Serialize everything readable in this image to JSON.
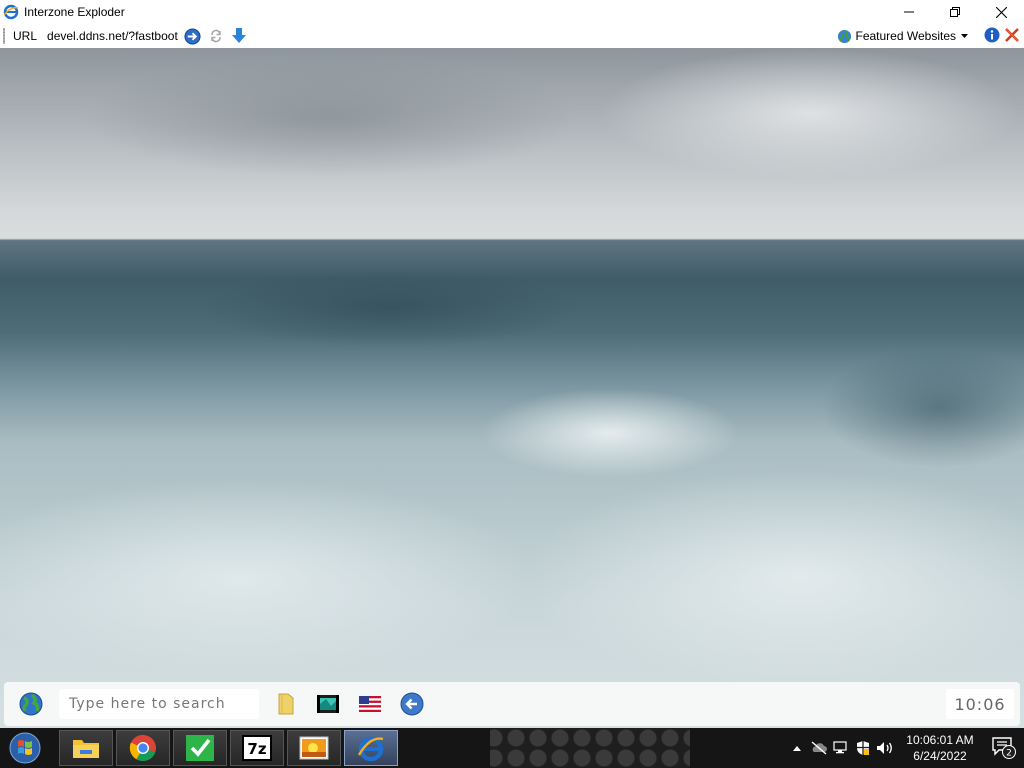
{
  "window": {
    "title": "Interzone Exploder",
    "controls": {
      "minimize": "minimize",
      "maximize": "restore",
      "close": "close"
    }
  },
  "addressbar": {
    "url_label": "URL",
    "url_value": "devel.ddns.net/?fastboot",
    "featured_label": "Featured Websites"
  },
  "dock": {
    "search_placeholder": "Type here to search",
    "clock": "10:06",
    "apps": [
      "folder-icon",
      "film-icon",
      "us-flag-icon",
      "back-arrow-icon"
    ]
  },
  "taskbar": {
    "apps": [
      "explorer",
      "chrome",
      "checkmark-app",
      "7-zip",
      "photo-viewer",
      "interzone-exploder"
    ],
    "time": "10:06:01 AM",
    "date": "6/24/2022",
    "notification_count": "2"
  },
  "colors": {
    "taskbar": "#1e1e1e",
    "ie_blue": "#1e6fd0",
    "accent_green": "#2db54a"
  }
}
